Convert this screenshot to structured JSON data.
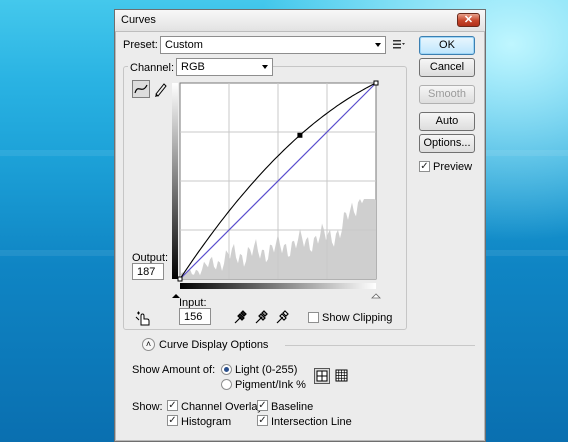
{
  "window": {
    "title": "Curves",
    "close_glyph": "✕"
  },
  "preset": {
    "label": "Preset:",
    "value": "Custom",
    "menu_icon": "preset-menu-icon"
  },
  "channel": {
    "label": "Channel:",
    "value": "RGB"
  },
  "buttons": {
    "ok": "OK",
    "cancel": "Cancel",
    "smooth": "Smooth",
    "auto": "Auto",
    "options": "Options..."
  },
  "preview": {
    "label": "Preview",
    "checked": true
  },
  "output": {
    "label": "Output:",
    "value": "187"
  },
  "input": {
    "label": "Input:",
    "value": "156"
  },
  "show_clipping": {
    "label": "Show Clipping",
    "checked": false
  },
  "curve_display_options": {
    "label": "Curve Display Options"
  },
  "show_amount": {
    "label": "Show Amount of:",
    "light": "Light  (0-255)",
    "pigment": "Pigment/Ink %",
    "selected": "light"
  },
  "show": {
    "label": "Show:",
    "channel_overlays": {
      "label": "Channel Overlays",
      "checked": true
    },
    "baseline": {
      "label": "Baseline",
      "checked": true
    },
    "histogram": {
      "label": "Histogram",
      "checked": true
    },
    "intersection_line": {
      "label": "Intersection Line",
      "checked": true
    }
  },
  "curve": {
    "control_point": {
      "input": 156,
      "output": 187
    },
    "curve_color": "#000000",
    "overlay_color": "#5b4fcf"
  }
}
